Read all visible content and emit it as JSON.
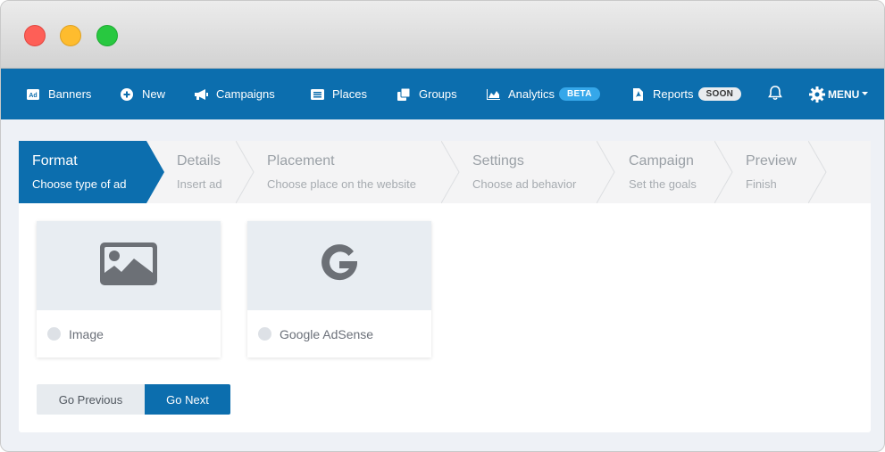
{
  "colors": {
    "primary": "#0c6eae",
    "beta_badge": "#35a7ea",
    "soon_badge": "#e9ecef"
  },
  "window": {
    "controls": [
      "close",
      "minimize",
      "maximize"
    ]
  },
  "nav": {
    "items": [
      {
        "label": "Banners",
        "icon": "ad-icon"
      },
      {
        "label": "New",
        "icon": "plus-circle-icon"
      },
      {
        "label": "Campaigns",
        "icon": "megaphone-icon"
      },
      {
        "label": "Places",
        "icon": "list-alt-icon"
      },
      {
        "label": "Groups",
        "icon": "copy-icon"
      },
      {
        "label": "Analytics",
        "icon": "chart-area-icon",
        "badge": "BETA"
      },
      {
        "label": "Reports",
        "icon": "file-pdf-icon",
        "badge": "SOON"
      }
    ],
    "notifications_icon": "bell-icon",
    "menu_label": "MENU",
    "menu_icon": "gear-icon"
  },
  "wizard": {
    "steps": [
      {
        "title": "Format",
        "subtitle": "Choose type of ad",
        "active": true
      },
      {
        "title": "Details",
        "subtitle": "Insert ad"
      },
      {
        "title": "Placement",
        "subtitle": "Choose place on the website"
      },
      {
        "title": "Settings",
        "subtitle": "Choose ad behavior"
      },
      {
        "title": "Campaign",
        "subtitle": "Set the goals"
      },
      {
        "title": "Preview",
        "subtitle": "Finish"
      }
    ],
    "options": [
      {
        "label": "Image",
        "icon": "image-icon",
        "selected": false
      },
      {
        "label": "Google AdSense",
        "icon": "google-icon",
        "selected": false
      }
    ],
    "buttons": {
      "previous": "Go Previous",
      "next": "Go Next"
    }
  }
}
